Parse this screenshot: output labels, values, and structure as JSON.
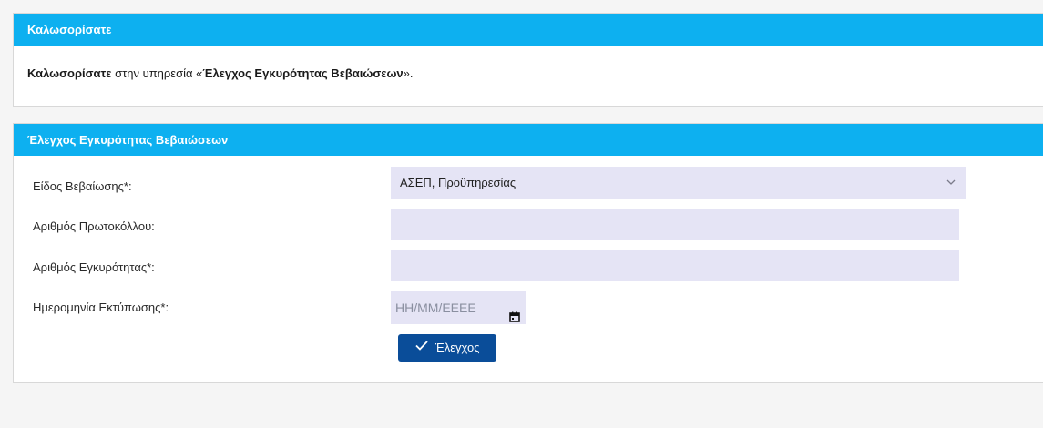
{
  "welcome_panel": {
    "header": "Καλωσορίσατε",
    "body_bold_1": "Καλωσορίσατε",
    "body_plain_1": " στην υπηρεσία «",
    "body_bold_2": "Έλεγχος Εγκυρότητας Βεβαιώσεων",
    "body_plain_2": "»."
  },
  "check_panel": {
    "header": "Έλεγχος Εγκυρότητας Βεβαιώσεων",
    "fields": {
      "certificate_type_label": "Είδος Βεβαίωσης*:",
      "certificate_type_value": "ΑΣΕΠ, Προϋπηρεσίας",
      "protocol_number_label": "Αριθμός Πρωτοκόλλου:",
      "protocol_number_value": "",
      "validity_number_label": "Αριθμός Εγκυρότητας*:",
      "validity_number_value": "",
      "print_date_label": "Ημερομηνία Εκτύπωσης*:",
      "print_date_placeholder": "ΗΗ/ΜΜ/ΕΕΕΕ"
    },
    "check_button_label": "Έλεγχος",
    "icons": {
      "dropdown": "chevron-down-icon",
      "calendar": "calendar-icon",
      "button": "check-icon"
    }
  },
  "colors": {
    "header_background": "#0db0f0",
    "field_background": "#e5e4f5",
    "button_background": "#0a4d99"
  }
}
